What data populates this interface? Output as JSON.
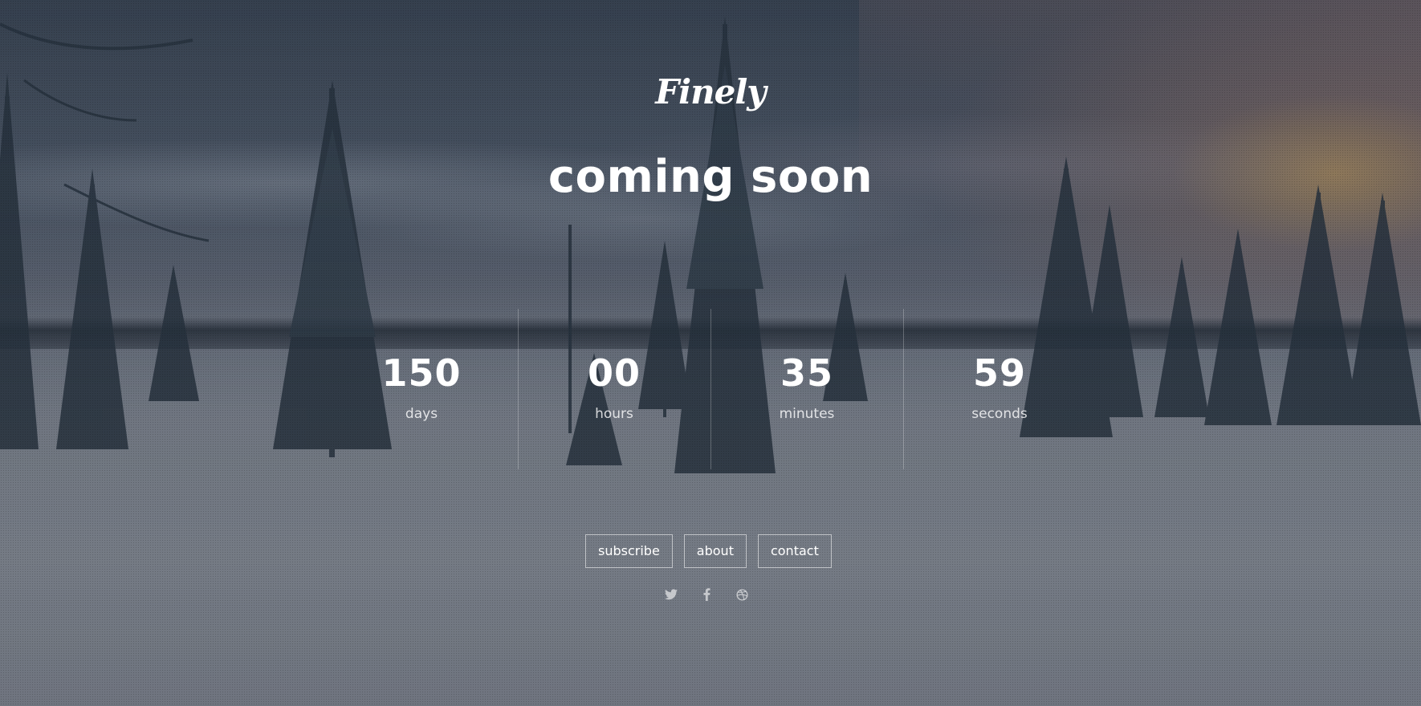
{
  "brand": {
    "logo_text": "Finely"
  },
  "hero": {
    "headline": "coming soon"
  },
  "countdown": [
    {
      "value": "150",
      "label": "days"
    },
    {
      "value": "00",
      "label": "hours"
    },
    {
      "value": "35",
      "label": "minutes"
    },
    {
      "value": "59",
      "label": "seconds"
    }
  ],
  "nav_buttons": {
    "subscribe": "subscribe",
    "about": "about",
    "contact": "contact"
  },
  "social": [
    "twitter-icon",
    "facebook-icon",
    "dribbble-icon"
  ],
  "colors": {
    "text": "#ffffff",
    "overlay": "#1e2837",
    "button_border": "#ffffff"
  }
}
